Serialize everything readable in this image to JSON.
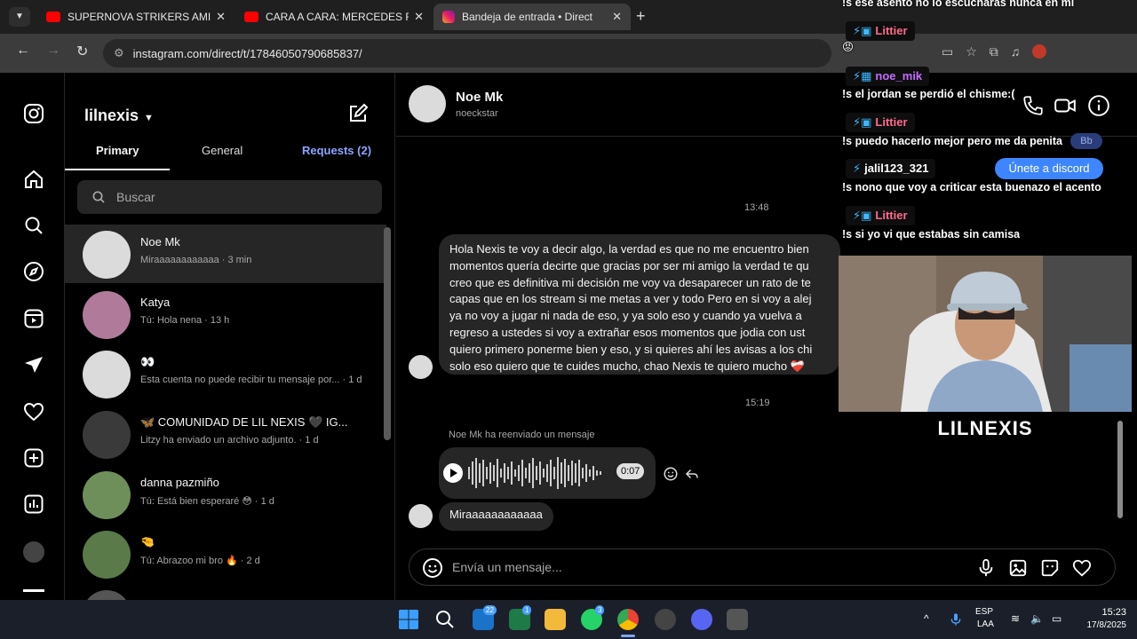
{
  "browser": {
    "tabs": [
      {
        "title": "SUPERNOVA STRIKERS AMIGO",
        "favicon": "youtube-icon"
      },
      {
        "title": "CARA A CARA: MERCEDES ROA",
        "favicon": "youtube-icon"
      },
      {
        "title": "Bandeja de entrada • Direct",
        "favicon": "instagram-icon"
      }
    ],
    "url": "instagram.com/direct/t/17846050790685837/"
  },
  "inbox": {
    "username": "lilnexis",
    "tabs": {
      "primary": "Primary",
      "general": "General",
      "requests": "Requests (2)"
    },
    "search_placeholder": "Buscar",
    "conversations": [
      {
        "name": "Noe Mk",
        "preview": "Miraaaaaaaaaaaa · 3 min"
      },
      {
        "name": "Katya",
        "preview": "Tú: Hola nena · 13 h"
      },
      {
        "name": "👀",
        "preview": "Esta cuenta no puede recibir tu mensaje por... · 1 d"
      },
      {
        "name": "🦋 COMUNIDAD DE LIL NEXIS 🖤 IG...",
        "preview": "Litzy ha enviado un archivo adjunto. · 1 d"
      },
      {
        "name": "danna pazmiño",
        "preview": "Tú: Está bien esperaré 😳 · 1 d"
      },
      {
        "name": "🤏",
        "preview": "Tú: Abrazoo mi bro 🔥 · 2 d"
      }
    ]
  },
  "chat": {
    "contact_name": "Noe Mk",
    "contact_username": "noeckstar",
    "timestamp1": "13:48",
    "long_message_lines": [
      "Hola Nexis te voy a decir algo, la verdad es que no me encuentro bien",
      "momentos quería decirte que gracias por ser mi amigo la verdad te qu",
      "creo que es definitiva mi decisión me voy va desaparecer un rato de te",
      "capas que en los stream si me metas a ver y todo Pero en si voy a alej",
      "ya no voy a jugar ni nada de eso,   y ya solo eso y cuando ya vuelva a",
      "regreso a ustedes si voy a extrañar esos momentos que  jodia con ust",
      "quiero primero ponerme bien y eso, y si quieres ahí les avisas a los chi",
      "solo eso quiero que te cuides mucho, chao Nexis te quiero mucho ❤️‍🩹"
    ],
    "timestamp2": "15:19",
    "forwarded_label": "Noe Mk ha reenviado un mensaje",
    "voice_duration": "0:07",
    "last_message": "Miraaaaaaaaaaaa",
    "composer_placeholder": "Envía un mensaje..."
  },
  "stream_chat": {
    "lines": [
      {
        "kind": "msg",
        "text": "!s ese asento no lo escucharas nunca en mi"
      },
      {
        "kind": "user",
        "text": "Littier",
        "color": "#ff6b8b"
      },
      {
        "kind": "msg",
        "text": "😡"
      },
      {
        "kind": "user",
        "text": "noe_mik",
        "color": "#c36bff"
      },
      {
        "kind": "msg",
        "text": "!s el jordan se perdió el chisme:("
      },
      {
        "kind": "user",
        "text": "Littier",
        "color": "#ff6b8b"
      },
      {
        "kind": "msg",
        "text": "!s puedo hacerlo mejor pero me da penita"
      },
      {
        "kind": "user",
        "text": "jalil123_321",
        "color": "#ffffff"
      },
      {
        "kind": "msg",
        "text": "!s nono que voy a criticar esta buenazo el acento"
      },
      {
        "kind": "user",
        "text": "Littier",
        "color": "#ff6b8b"
      },
      {
        "kind": "msg",
        "text": "!s si yo vi que estabas sin camisa"
      }
    ],
    "discord_button": "Únete a discord",
    "bb_label": "Bb"
  },
  "stream_brand": "LILNEXIS",
  "taskbar": {
    "badges": {
      "outlook": "22",
      "excel": "1",
      "whatsapp": "3"
    },
    "lang": "ESP",
    "layout": "LAA",
    "time": "15:23",
    "date": "17/8/2025"
  }
}
